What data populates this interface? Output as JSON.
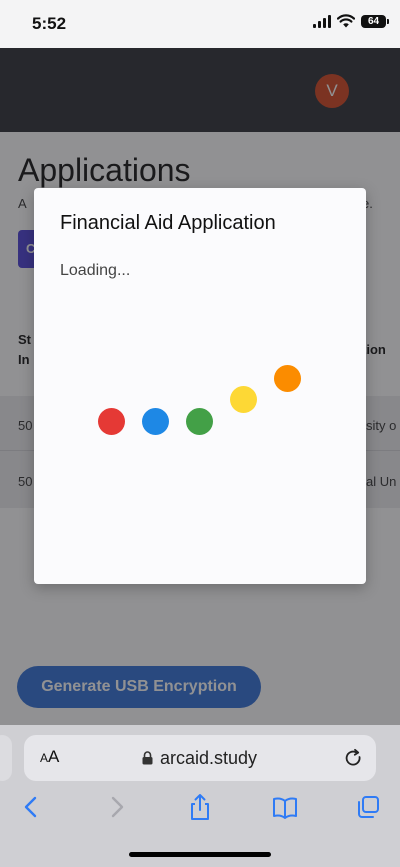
{
  "status_bar": {
    "time": "5:52",
    "battery": "64"
  },
  "header": {
    "avatar_initial": "V",
    "avatar_color": "#d2431c"
  },
  "page": {
    "title": "Applications",
    "subtitle_start": "A",
    "subtitle_end": "e.",
    "chip_label": "C",
    "column_left": "St\nIn",
    "column_right": "tion",
    "rows": [
      {
        "left": "50",
        "right": "sity o"
      },
      {
        "left": "50",
        "right": "al Un"
      }
    ],
    "usb_button_label": "Generate USB Encryption",
    "usb_button_color": "#2f6ed6"
  },
  "modal": {
    "title": "Financial Aid Application",
    "status": "Loading...",
    "dots": [
      {
        "name": "red-dot",
        "color": "#e53935"
      },
      {
        "name": "blue-dot",
        "color": "#1e88e5"
      },
      {
        "name": "green-dot",
        "color": "#43a047"
      },
      {
        "name": "yellow-dot",
        "color": "#fdd835"
      },
      {
        "name": "orange-dot",
        "color": "#fb8c00"
      }
    ]
  },
  "browser": {
    "text_size_label": "AA",
    "url": "arcaid.study",
    "icons": [
      "back-icon",
      "forward-icon",
      "share-icon",
      "bookmarks-icon",
      "tabs-icon"
    ]
  }
}
